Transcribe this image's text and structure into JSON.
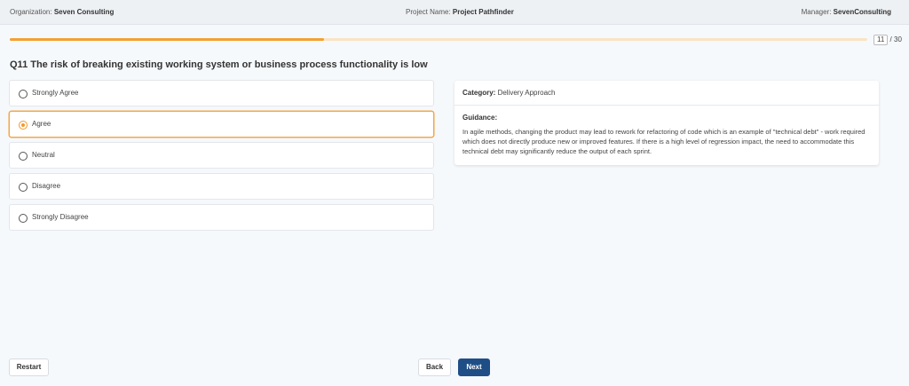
{
  "header": {
    "org_label": "Organization:",
    "org_value": "Seven Consulting",
    "project_label": "Project Name:",
    "project_value": "Project Pathfinder",
    "manager_label": "Manager:",
    "manager_value": "SevenConsulting"
  },
  "progress": {
    "current": "11",
    "total": "/ 30",
    "fraction": 0.366
  },
  "question": {
    "text": "Q11 The risk of breaking existing working system or business process functionality is low"
  },
  "options": [
    {
      "label": "Strongly Agree",
      "selected": false
    },
    {
      "label": "Agree",
      "selected": true
    },
    {
      "label": "Neutral",
      "selected": false
    },
    {
      "label": "Disagree",
      "selected": false
    },
    {
      "label": "Strongly Disagree",
      "selected": false
    }
  ],
  "info": {
    "category_label": "Category:",
    "category_value": "Delivery Approach",
    "guidance_title": "Guidance:",
    "guidance_text": "In agile methods, changing the product may lead to rework for refactoring of code which is an example of \"technical debt\" - work required which does not directly produce new or improved features. If there is a high level of regression impact, the need to accommodate this technical debt may significantly reduce the output of each sprint."
  },
  "buttons": {
    "restart": "Restart",
    "back": "Back",
    "next": "Next"
  },
  "colors": {
    "accent": "#f5a030",
    "primary": "#1f4e86"
  }
}
